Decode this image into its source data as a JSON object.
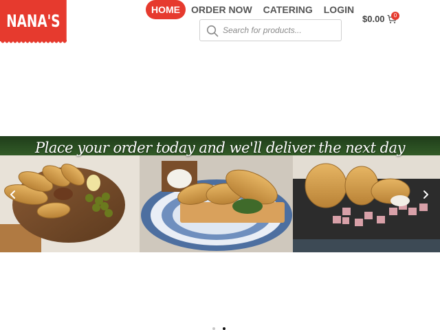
{
  "brand": {
    "logo_text": "NANA'S",
    "logo_color": "#e63a2e"
  },
  "nav": {
    "items": [
      {
        "label": "HOME",
        "active": true
      },
      {
        "label": "ORDER NOW",
        "active": false
      },
      {
        "label": "CATERING",
        "active": false
      },
      {
        "label": "LOGIN",
        "active": false
      }
    ]
  },
  "search": {
    "placeholder": "Search for products...",
    "value": "",
    "icon": "search-icon"
  },
  "cart": {
    "total": "$0.00",
    "count": "0",
    "icon": "cart-icon"
  },
  "banner": {
    "caption": "Place your order today and we'll deliver the next day",
    "slides": [
      {
        "image": "empanadas-on-wooden-board-with-olives"
      },
      {
        "image": "empanadas-on-blue-lace-cloth"
      },
      {
        "image": "empanadas-with-ham-cubes-on-dark-slate"
      }
    ]
  },
  "carousel": {
    "prev_icon": "chevron-left-icon",
    "next_icon": "chevron-right-icon",
    "active_dot": 2,
    "dot_count": 2
  },
  "colors": {
    "accent": "#e63a2e",
    "nav_text": "#555555"
  }
}
